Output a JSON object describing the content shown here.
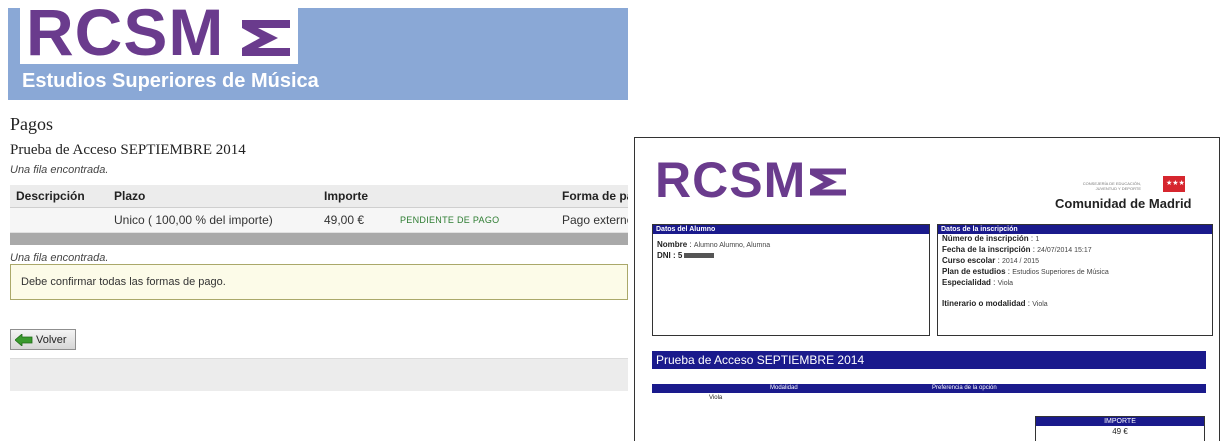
{
  "header": {
    "logo_text": "RCSM",
    "title": "Estudios Superiores de Música"
  },
  "page": {
    "title": "Pagos",
    "subtitle": "Prueba de Acceso SEPTIEMBRE 2014",
    "found_text_top": "Una fila encontrada.",
    "found_text_bottom": "Una fila encontrada."
  },
  "table": {
    "columns": [
      "Descripción",
      "Plazo",
      "Importe",
      "",
      "Forma de pag"
    ],
    "rows": [
      {
        "descripcion": "",
        "plazo": "Unico ( 100,00 % del importe)",
        "importe": "49,00 €",
        "estado": "PENDIENTE DE PAGO",
        "forma": "Pago externo"
      }
    ]
  },
  "notice": {
    "text": "Debe confirmar todas las formas de pago."
  },
  "buttons": {
    "back_label": "Volver"
  },
  "pdf": {
    "logo_text": "RCSM",
    "org_small": "CONSEJERÍA DE EDUCACIÓN, JUVENTUD Y DEPORTE",
    "org_name": "Comunidad de Madrid",
    "alumno": {
      "header": "Datos del Alumno",
      "nombre_label": "Nombre",
      "nombre_value": "Alumno Alumno, Alumna",
      "dni_label": "DNI : 5"
    },
    "inscripcion": {
      "header": "Datos de la inscripción",
      "numero_label": "Número de inscripción",
      "numero_value": "1",
      "fecha_label": "Fecha de la inscripción",
      "fecha_value": "24/07/2014 15:17",
      "curso_label": "Curso escolar",
      "curso_value": "2014 / 2015",
      "plan_label": "Plan de estudios",
      "plan_value": "Estudios Superiores de Música",
      "especialidad_label": "Especialidad",
      "especialidad_value": "Viola",
      "itinerario_label": "Itinerario o modalidad",
      "itinerario_value": "Viola"
    },
    "band_title": "Prueba de Acceso SEPTIEMBRE 2014",
    "table_columns": [
      "Modalidad",
      "Preferencia de la opción"
    ],
    "table_value": "Viola",
    "importe_header": "IMPORTE",
    "importe_value": "49 €"
  },
  "colors": {
    "banner": "#8aa8d6",
    "logo_purple": "#6a3b8d",
    "pdf_blue": "#1a1a8c",
    "status_green": "#2e7d32"
  }
}
